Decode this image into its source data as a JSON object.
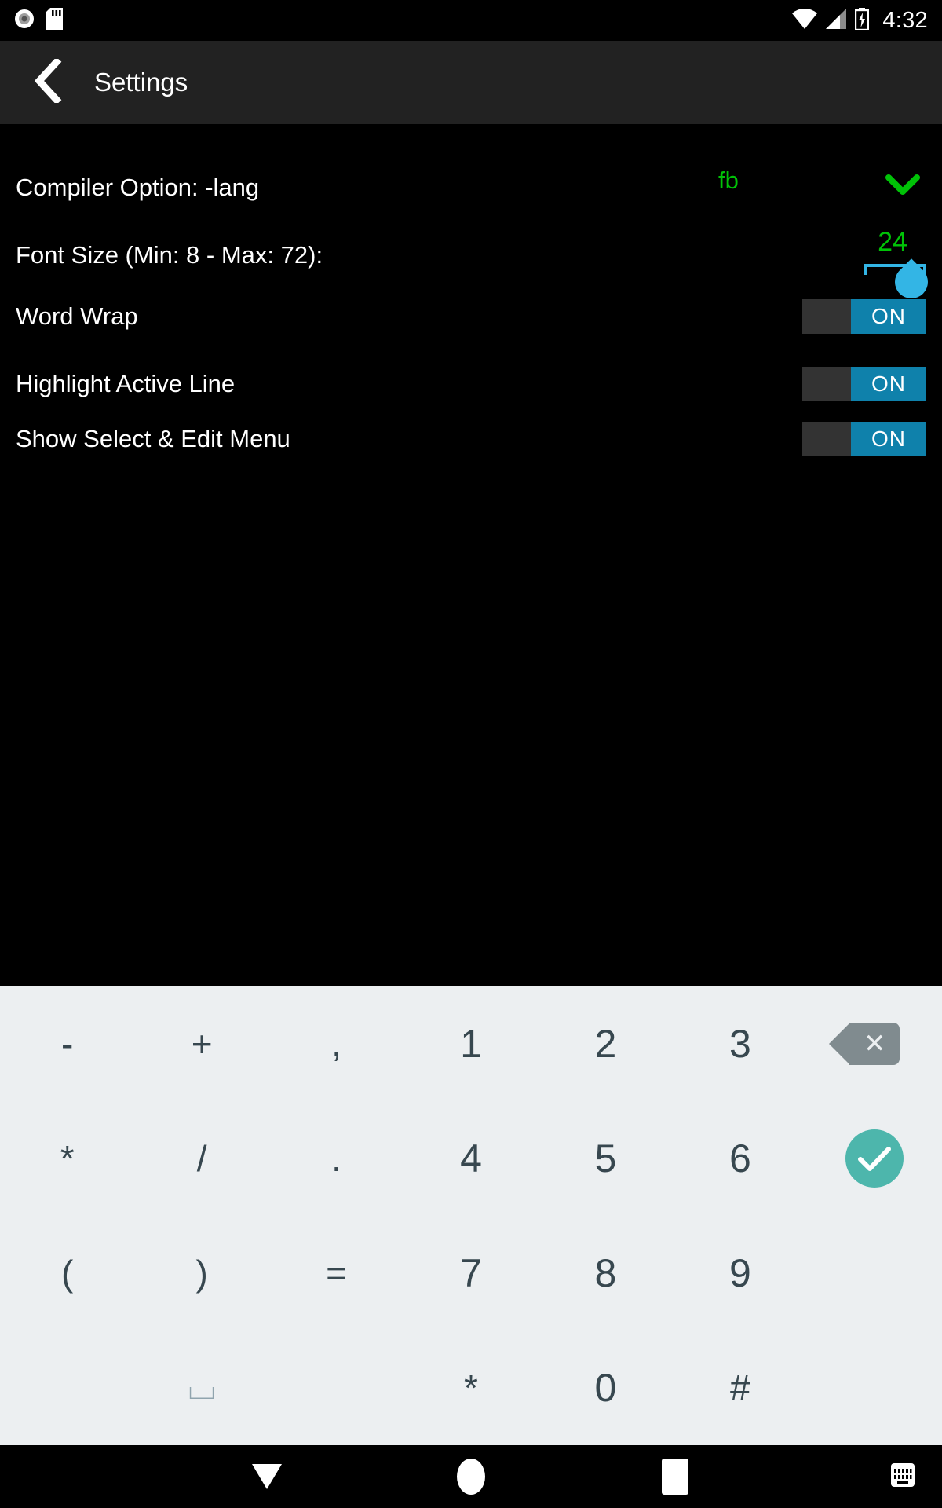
{
  "status_bar": {
    "left_icons": [
      "record-circle-icon",
      "sd-card-icon"
    ],
    "right_icons": [
      "wifi-icon",
      "cellular-signal-icon",
      "battery-charging-icon"
    ],
    "clock": "4:32"
  },
  "app_bar": {
    "back_icon": "back-chevron-icon",
    "title": "Settings"
  },
  "settings": {
    "compiler_option": {
      "label": "Compiler Option: -lang",
      "value": "fb",
      "dropdown_icon": "chevron-down-icon",
      "value_color": "#00C207"
    },
    "font_size": {
      "label": "Font Size (Min: 8 - Max: 72):",
      "value": "24",
      "min": 8,
      "max": 72,
      "value_color": "#00C207",
      "cursor_color": "#33B5E5"
    },
    "toggles": [
      {
        "label": "Word Wrap",
        "state": "ON"
      },
      {
        "label": "Highlight Active Line",
        "state": "ON"
      },
      {
        "label": "Show Select & Edit Menu",
        "state": "ON"
      }
    ],
    "toggle_on_color": "#0f81ab",
    "toggle_track_color": "#333333"
  },
  "keyboard": {
    "background": "#ECEFF1",
    "key_color": "#37474F",
    "backspace_color": "#808B8F",
    "enter_color": "#4DB6AC",
    "rows": [
      [
        "-",
        "+",
        ",",
        "1",
        "2",
        "3",
        "backspace-key"
      ],
      [
        "*",
        "/",
        ".",
        "4",
        "5",
        "6",
        "enter-key"
      ],
      [
        "(",
        ")",
        "=",
        "7",
        "8",
        "9",
        ""
      ],
      [
        "",
        "⌴",
        "",
        "*",
        "0",
        "#",
        ""
      ]
    ],
    "keys": {
      "minus": "-",
      "plus": "+",
      "comma": ",",
      "one": "1",
      "two": "2",
      "three": "3",
      "asterisk": "*",
      "slash": "/",
      "period": ".",
      "four": "4",
      "five": "5",
      "six": "6",
      "lparen": "(",
      "rparen": ")",
      "equals": "=",
      "seven": "7",
      "eight": "8",
      "nine": "9",
      "space": "⌴",
      "asterisk2": "*",
      "zero": "0",
      "hash": "#",
      "backspace_icon": "backspace-icon",
      "enter_icon": "check-icon"
    }
  },
  "nav_bar": {
    "back_icon": "triangle-down-back-icon",
    "home_icon": "circle-home-icon",
    "recent_icon": "square-recents-icon",
    "keyboard_switch_icon": "keyboard-switcher-icon"
  }
}
